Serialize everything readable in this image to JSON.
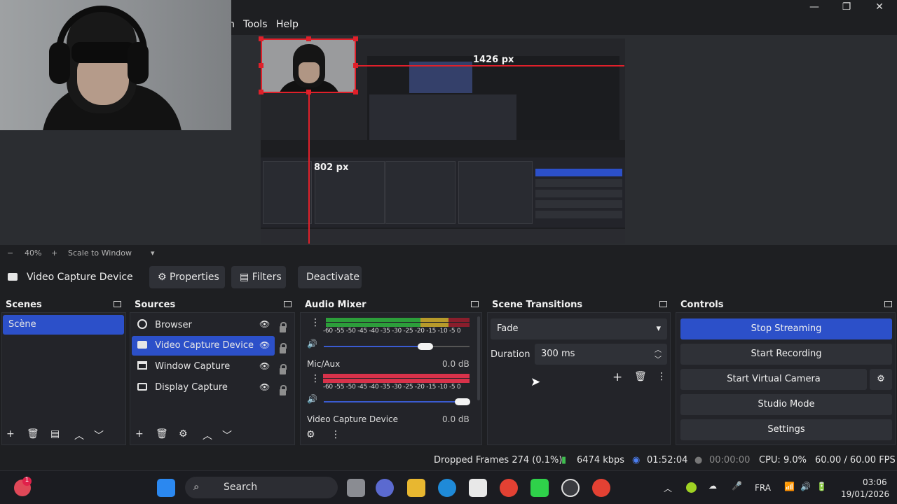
{
  "menu": {
    "items": [
      "n",
      "Tools",
      "Help"
    ]
  },
  "window": {
    "minimize": "—",
    "maximize": "❐",
    "close": "✕"
  },
  "preview": {
    "width_label": "1426 px",
    "height_label": "802 px"
  },
  "zoom": {
    "minus": "−",
    "value": "40%",
    "plus": "+",
    "mode": "Scale to Window"
  },
  "source_toolbar": {
    "current_source": "Video Capture Device",
    "properties": "Properties",
    "filters": "Filters",
    "deactivate": "Deactivate"
  },
  "scenes": {
    "title": "Scenes",
    "items": [
      "Scène"
    ]
  },
  "sources": {
    "title": "Sources",
    "items": [
      "Browser",
      "Video Capture Device",
      "Window Capture",
      "Display Capture"
    ]
  },
  "audio_mixer": {
    "title": "Audio Mixer",
    "scale": "-60 -55 -50 -45 -40 -35 -30 -25 -20 -15 -10 -5 0",
    "channels": [
      {
        "name": "",
        "db": "",
        "volume": 0.87
      },
      {
        "name": "Mic/Aux",
        "db": "0.0 dB",
        "volume": 1.0
      },
      {
        "name": "Video Capture Device",
        "db": "0.0 dB"
      }
    ]
  },
  "scene_transitions": {
    "title": "Scene Transitions",
    "transition": "Fade",
    "duration_label": "Duration",
    "duration_value": "300 ms"
  },
  "controls": {
    "title": "Controls",
    "stop_streaming": "Stop Streaming",
    "start_recording": "Start Recording",
    "start_virtual_camera": "Start Virtual Camera",
    "studio_mode": "Studio Mode",
    "settings": "Settings"
  },
  "status": {
    "dropped": "Dropped Frames 274 (0.1%)",
    "bitrate": "6474 kbps",
    "stream_time": "01:52:04",
    "rec_time": "00:00:00",
    "cpu": "CPU: 9.0%",
    "fps": "60.00 / 60.00 FPS"
  },
  "taskbar": {
    "search": "Search",
    "language": "FRA",
    "time": "03:06",
    "date": "19/01/2026",
    "notification_count": "1"
  },
  "colors": {
    "accent": "#2c50c9",
    "guide": "#e0202a",
    "meter_green": "#2c9e3a",
    "meter_red": "#d8324a"
  }
}
